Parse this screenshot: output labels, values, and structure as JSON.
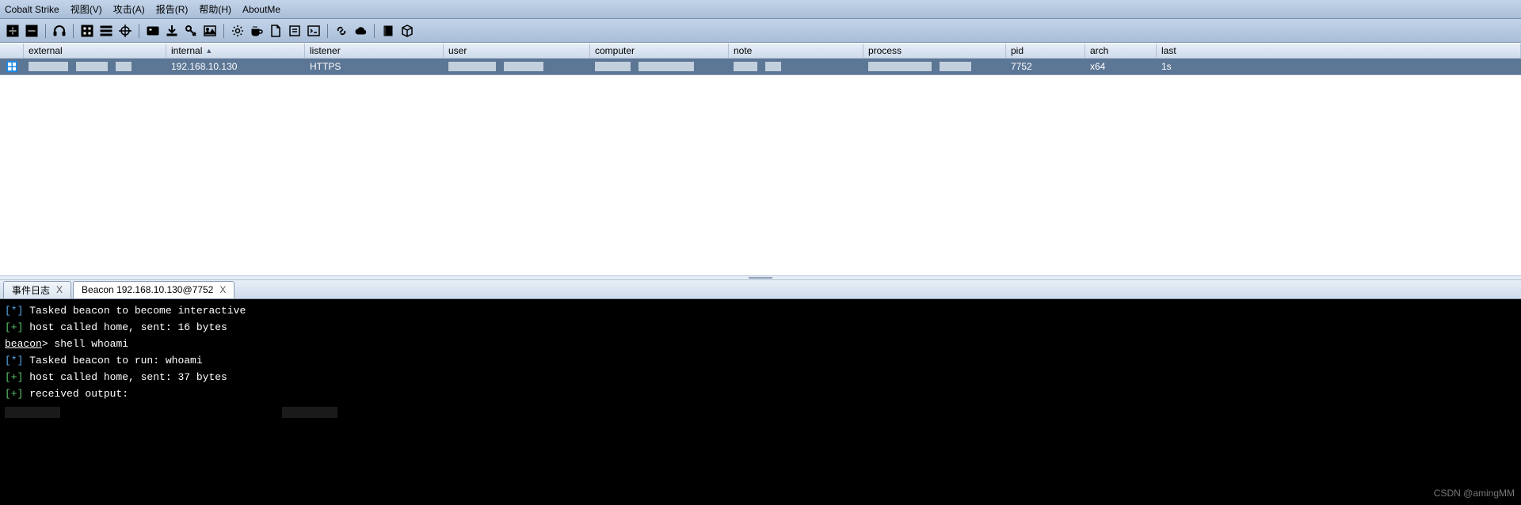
{
  "menubar": {
    "app": "Cobalt Strike",
    "view": "视图(V)",
    "attack": "攻击(A)",
    "report": "报告(R)",
    "help": "帮助(H)",
    "about": "AboutMe"
  },
  "toolbar_icons": [
    "plus-icon",
    "minus-icon",
    "sep",
    "headphones-icon",
    "sep",
    "squares-icon",
    "list-icon",
    "target-icon",
    "sep",
    "card-icon",
    "download-icon",
    "key-icon",
    "image-icon",
    "sep",
    "gear-icon",
    "coffee-icon",
    "document-icon",
    "note-icon",
    "terminal-icon",
    "sep",
    "link-icon",
    "cloud-icon",
    "sep",
    "book-icon",
    "cube-icon"
  ],
  "columns": {
    "external": "external",
    "internal": "internal",
    "listener": "listener",
    "user": "user",
    "computer": "computer",
    "note": "note",
    "process": "process",
    "pid": "pid",
    "arch": "arch",
    "last": "last"
  },
  "sort_indicator": "▲",
  "row": {
    "internal": "192.168.10.130",
    "listener": "HTTPS",
    "pid": "7752",
    "arch": "x64",
    "last": "1s"
  },
  "tabs": {
    "eventlog": "事件日志",
    "beacon": "Beacon 192.168.10.130@7752",
    "close": "X"
  },
  "console": {
    "l1_prefix": "[*]",
    "l1_text": " Tasked beacon to become interactive",
    "l2_prefix": "[+]",
    "l2_text": " host called home, sent: 16 bytes",
    "prompt": "beacon",
    "prompt_sep": ">",
    "cmd": " shell whoami",
    "l4_prefix": "[*]",
    "l4_text": " Tasked beacon to run: whoami",
    "l5_prefix": "[+]",
    "l5_text": " host called home, sent: 37 bytes",
    "l6_prefix": "[+]",
    "l6_text": " received output:"
  },
  "watermark": "CSDN @amingMM"
}
